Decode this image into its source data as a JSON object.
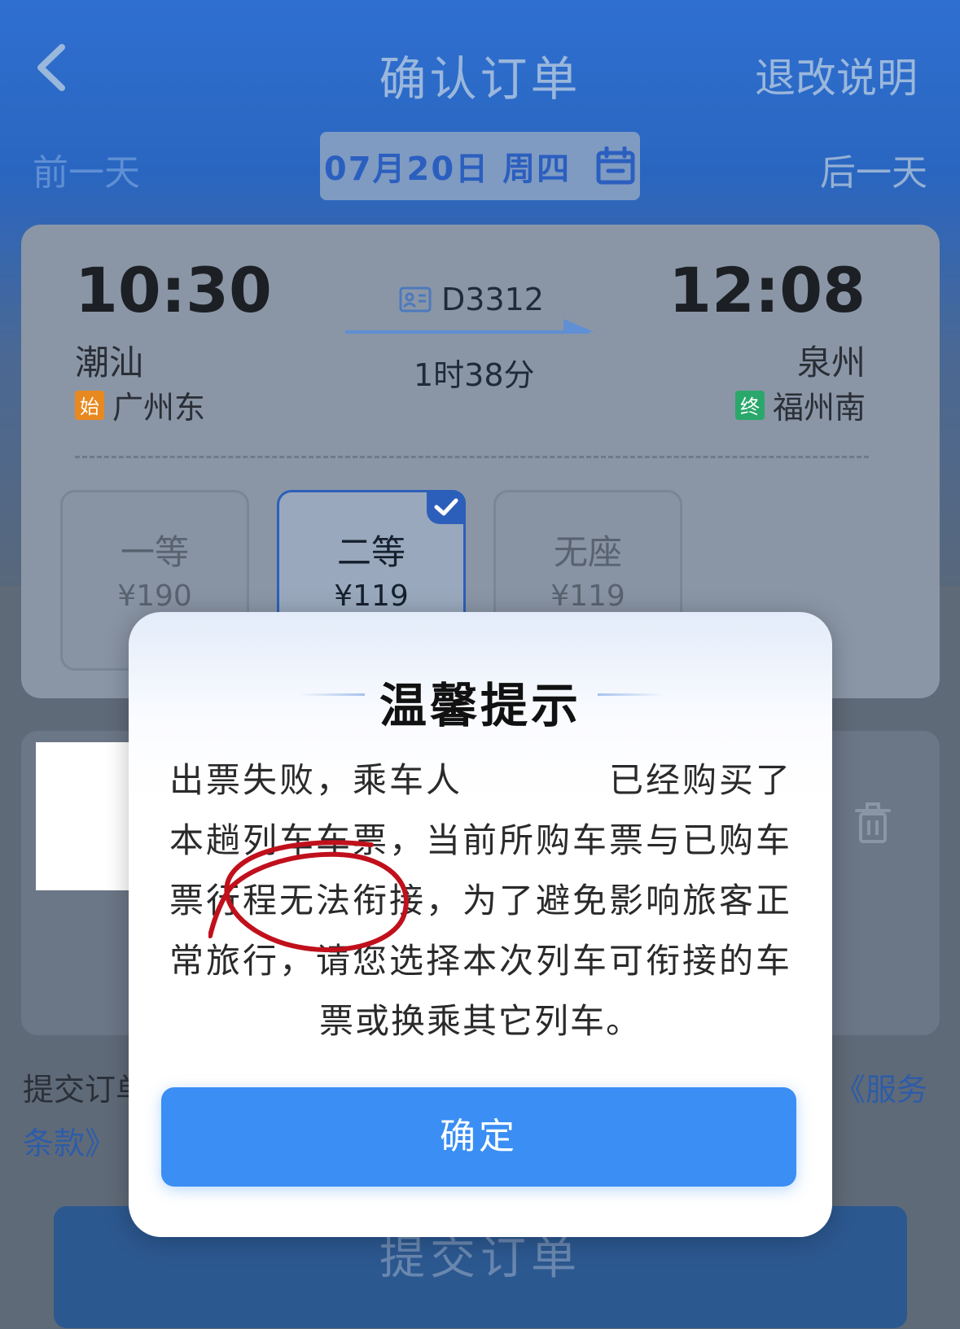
{
  "nav": {
    "title": "确认订单",
    "refund_label": "退改说明",
    "prev_day": "前一天",
    "next_day": "后一天",
    "date": "07月20日 周四"
  },
  "trip": {
    "depart_time": "10:30",
    "depart_station": "潮汕",
    "origin_tag": "始",
    "origin_station": "广州东",
    "train_no": "D3312",
    "duration": "1时38分",
    "arrive_time": "12:08",
    "arrive_station": "泉州",
    "terminal_tag": "终",
    "terminal_station": "福州南"
  },
  "seats": [
    {
      "name": "一等",
      "price": "¥190",
      "selected": false
    },
    {
      "name": "二等",
      "price": "¥119",
      "selected": true
    },
    {
      "name": "无座",
      "price": "¥119",
      "selected": false
    }
  ],
  "terms": {
    "prefix": "提交订单",
    "link_part1": "《服务",
    "link_part2": "条款》"
  },
  "submit_label": "提交订单",
  "dialog": {
    "title": "温馨提示",
    "message": "出票失败，乘车人　　　　已经购买了本趟列车车票，当前所购车票与已购车票行程无法衔接，为了避免影响旅客正常旅行，请您选择本次列车可衔接的车票或换乘其它列车。",
    "confirm_label": "确定"
  },
  "colors": {
    "brand_blue": "#2f6fd0",
    "button_blue": "#3a8ef4",
    "origin_tag": "#e8891f",
    "terminal_tag": "#2aa86b",
    "annotation_red": "#c0101c"
  }
}
